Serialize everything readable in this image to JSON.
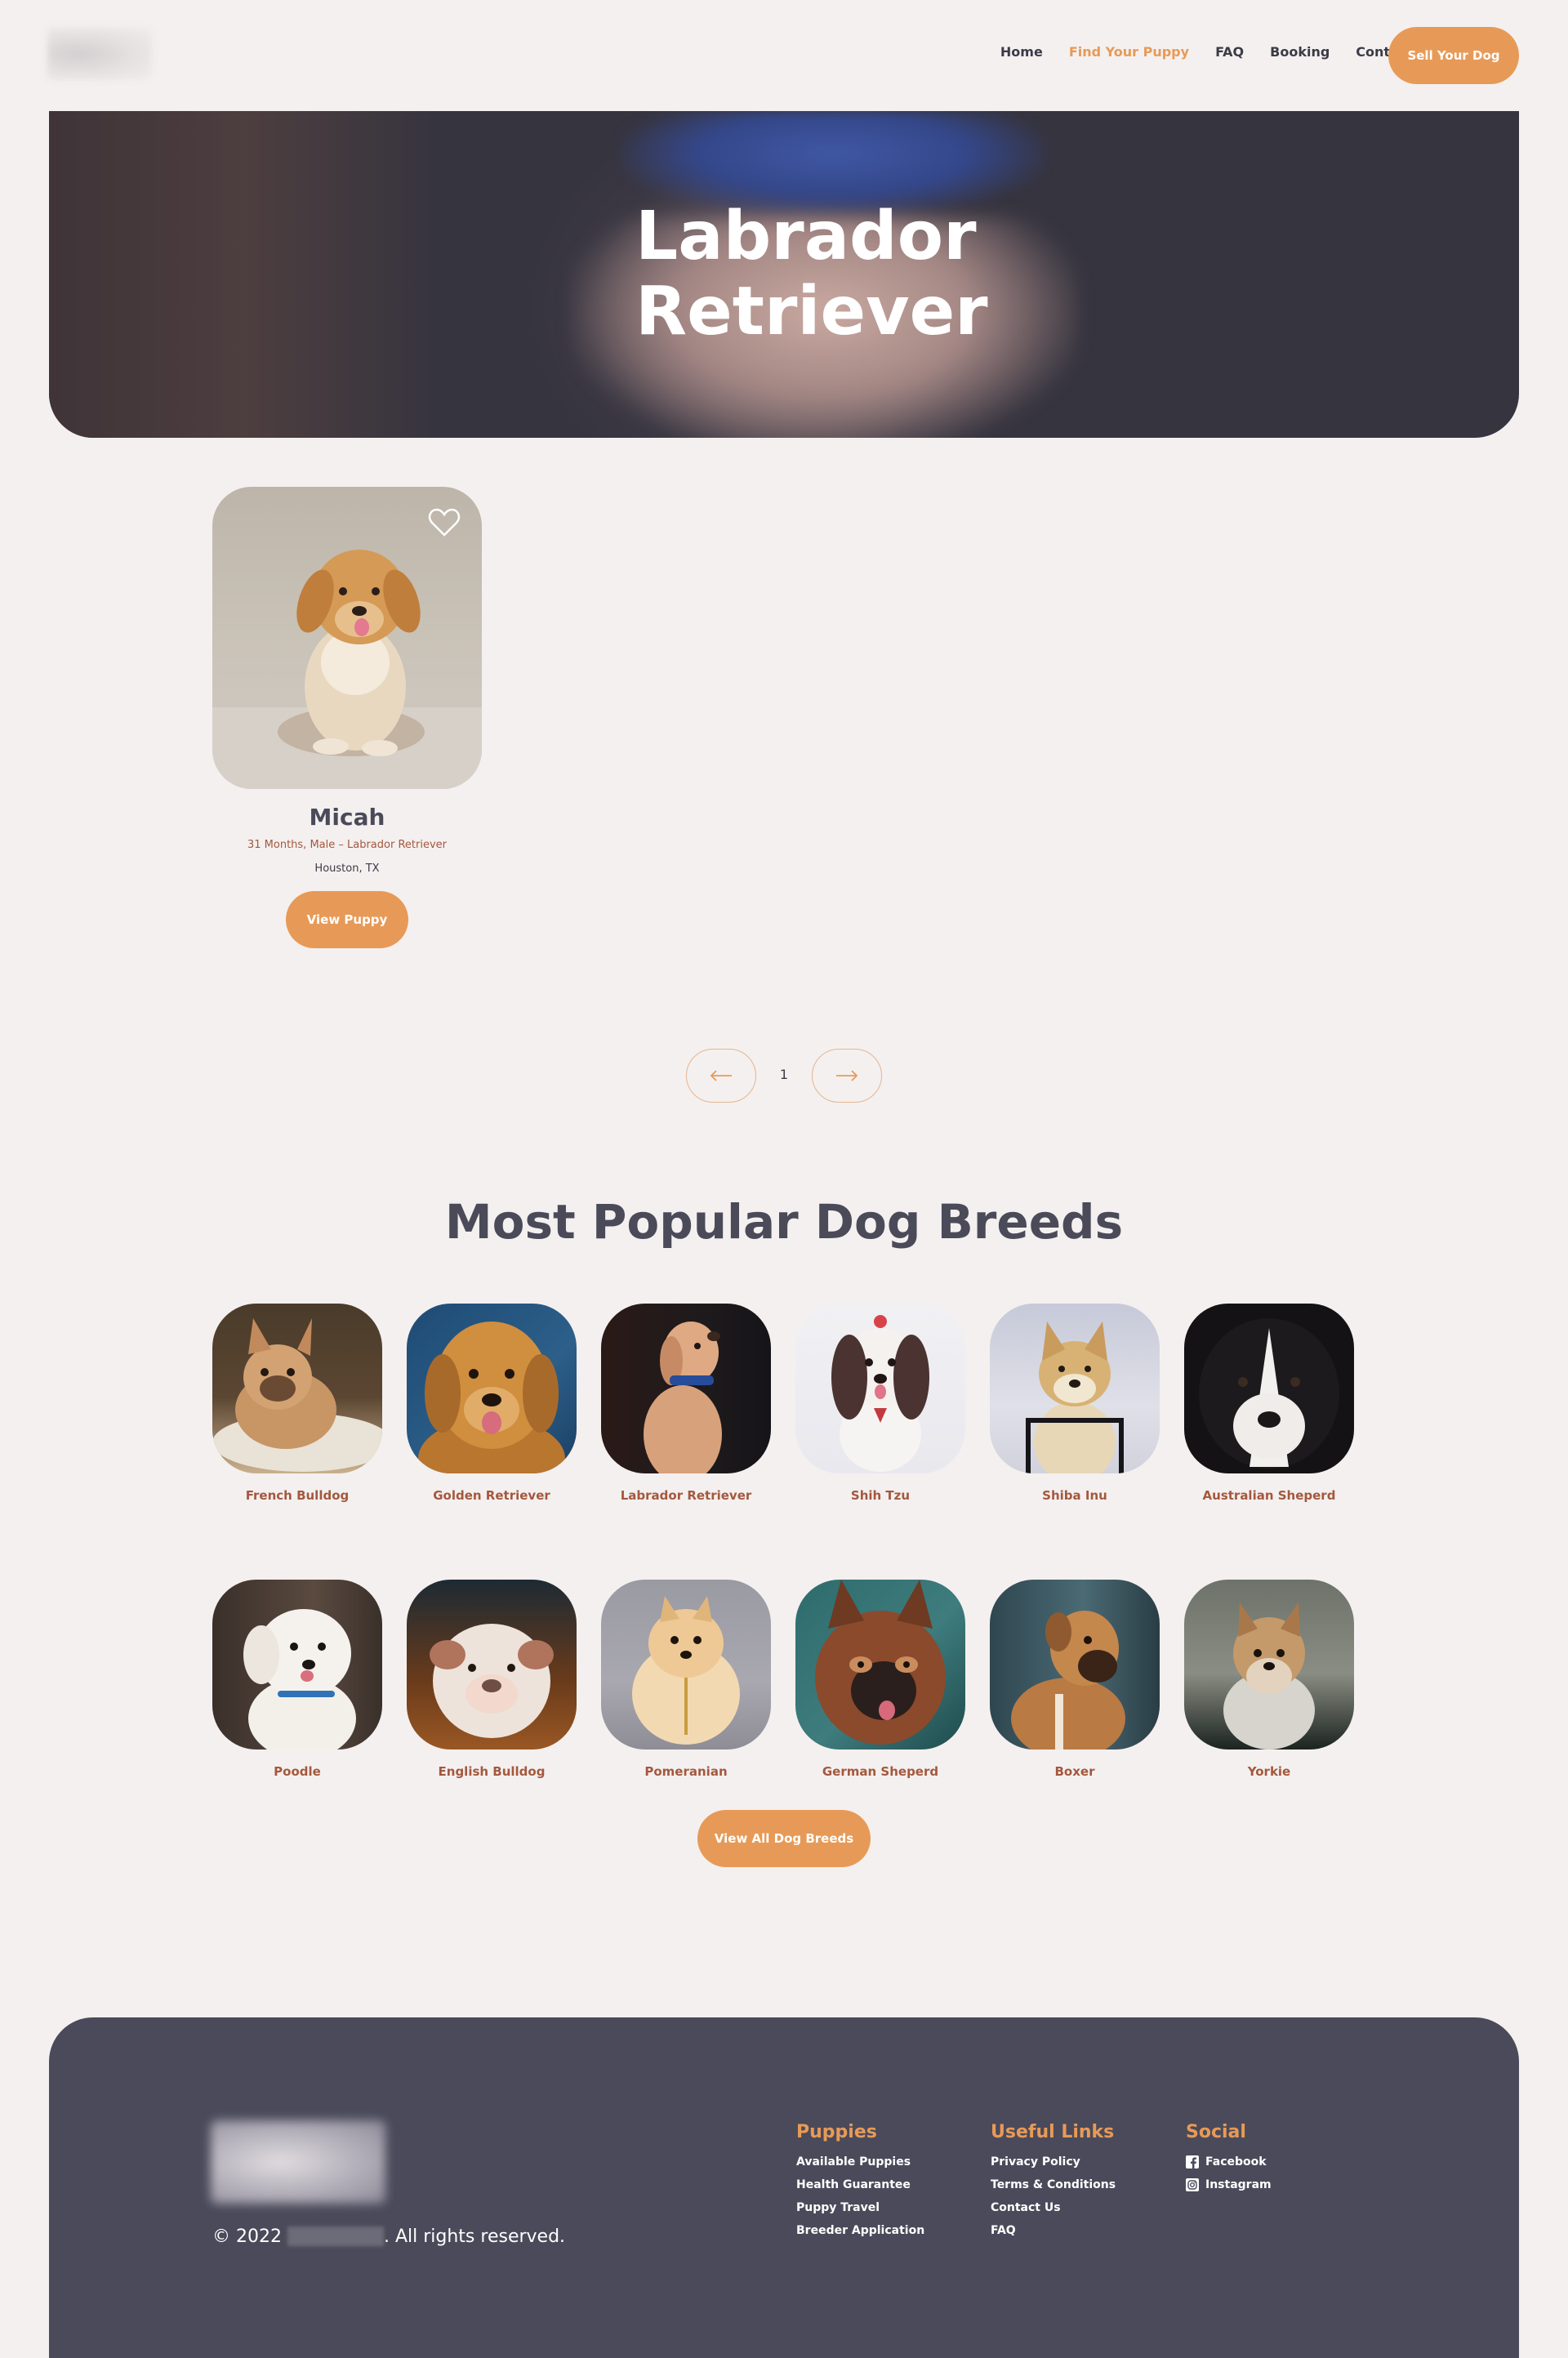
{
  "header": {
    "nav": [
      "Home",
      "Find Your Puppy",
      "FAQ",
      "Booking",
      "Contact"
    ],
    "active_nav": "Find Your Puppy",
    "cta": "Sell Your Dog"
  },
  "hero": {
    "title_line1": "Labrador",
    "title_line2": "Retriever"
  },
  "puppy": {
    "name": "Micah",
    "meta": "31 Months, Male – Labrador Retriever",
    "location": "Houston, TX",
    "button": "View Puppy"
  },
  "pagination": {
    "current": "1"
  },
  "breeds": {
    "title": "Most Popular Dog Breeds",
    "items": [
      "French Bulldog",
      "Golden Retriever",
      "Labrador Retriever",
      "Shih Tzu",
      "Shiba Inu",
      "Australian Sheperd",
      "Poodle",
      "English Bulldog",
      "Pomeranian",
      "German Sheperd",
      "Boxer",
      "Yorkie"
    ],
    "button": "View All Dog Breeds"
  },
  "footer": {
    "copyright_prefix": "© 2022",
    "copyright_suffix": ". All rights reserved.",
    "columns": {
      "puppies": {
        "title": "Puppies",
        "links": [
          "Available Puppies",
          "Health Guarantee",
          "Puppy Travel",
          "Breeder Application"
        ]
      },
      "useful": {
        "title": "Useful Links",
        "links": [
          "Privacy Policy",
          "Terms & Conditions",
          "Contact Us",
          "FAQ"
        ]
      },
      "social": {
        "title": "Social",
        "links": [
          "Facebook",
          "Instagram"
        ]
      }
    }
  },
  "colors": {
    "accent": "#e79a57",
    "background": "#f4f0ef",
    "footer": "#4a4a5a",
    "breed_label": "#a4583e"
  }
}
